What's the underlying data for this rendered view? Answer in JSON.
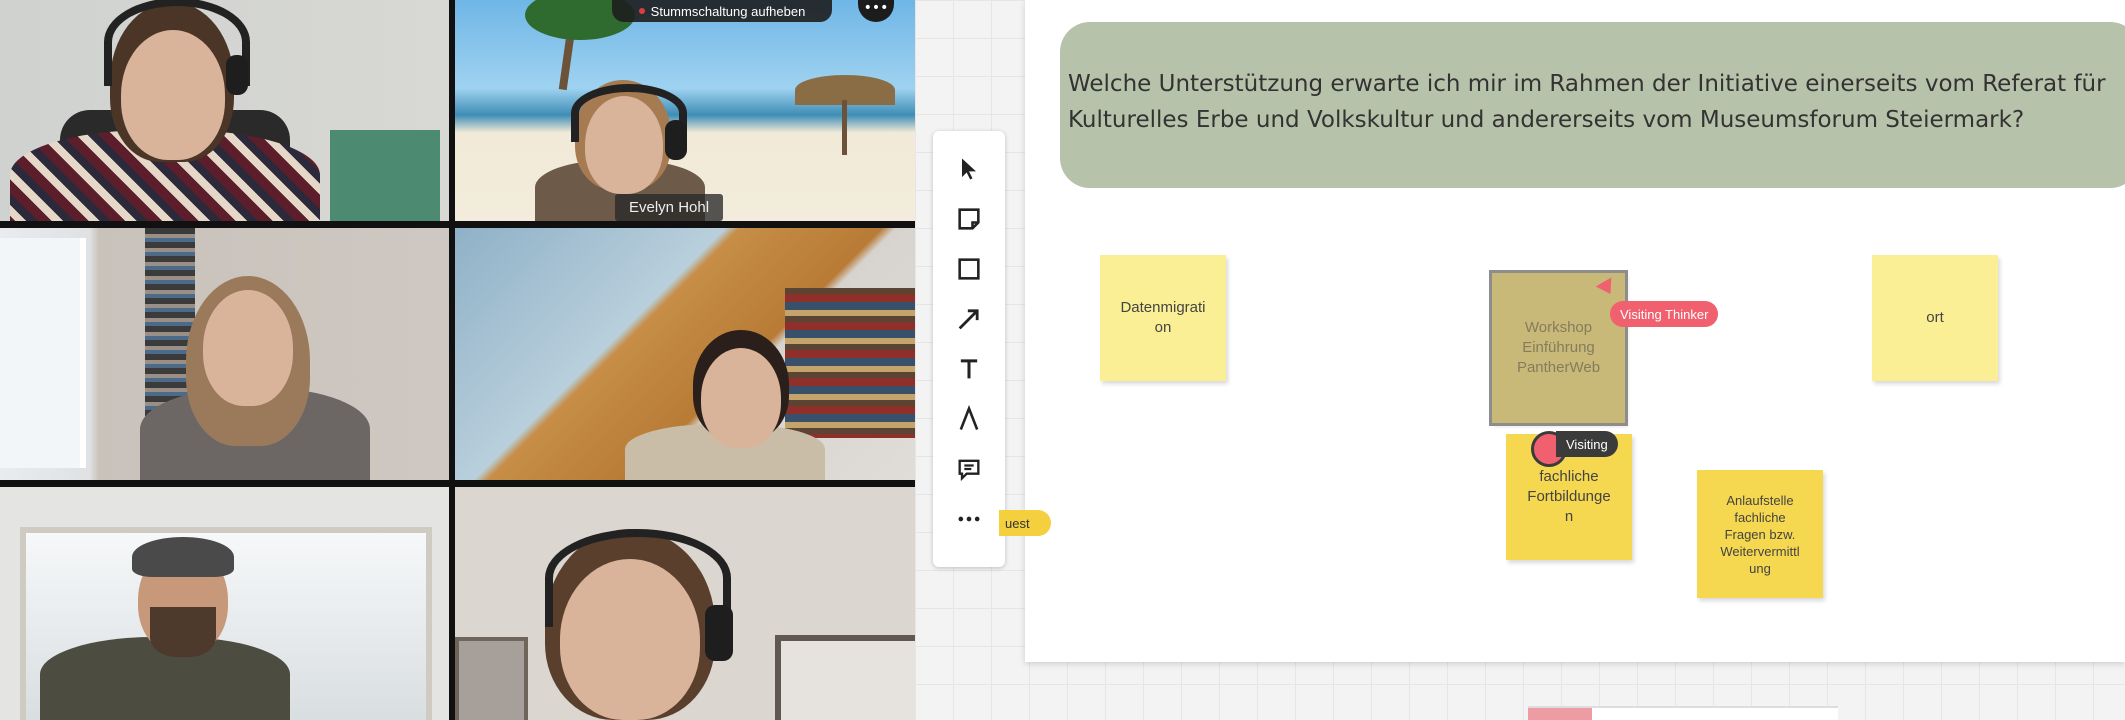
{
  "meeting": {
    "unmute_banner": "Stummschaltung aufheben",
    "participants": [
      {
        "name": ""
      },
      {
        "name": "Evelyn Hohl"
      },
      {
        "name": ""
      },
      {
        "name": ""
      },
      {
        "name": ""
      },
      {
        "name": ""
      }
    ],
    "more_icon": "more-horizontal-icon"
  },
  "whiteboard": {
    "question": "Welche Unterstützung erwarte ich mir im Rahmen der Initiative einerseits vom Referat für Kulturelles Erbe und Volkskultur und andererseits vom Museumsforum Steiermark?",
    "guest_label": "uest",
    "tools": [
      {
        "name": "select-pointer-icon"
      },
      {
        "name": "sticky-note-icon"
      },
      {
        "name": "rectangle-icon"
      },
      {
        "name": "arrow-icon"
      },
      {
        "name": "text-icon"
      },
      {
        "name": "pen-icon"
      },
      {
        "name": "comment-icon"
      },
      {
        "name": "more-icon"
      }
    ],
    "stickies": [
      {
        "text": "Datenmigrati\non"
      },
      {
        "text": "Workshop\nEinführung\nPantherWeb"
      },
      {
        "text": "ort"
      },
      {
        "text": "fachliche\nFortbildunge\nn"
      },
      {
        "text": "Anlaufstelle\nfachliche\nFragen bzw.\nWeitervermittl\nung"
      }
    ],
    "cursors": [
      {
        "label": "Visiting Thinker",
        "color": "#f0606e"
      },
      {
        "label": "Visiting",
        "color": "#3b3b3b"
      }
    ]
  }
}
